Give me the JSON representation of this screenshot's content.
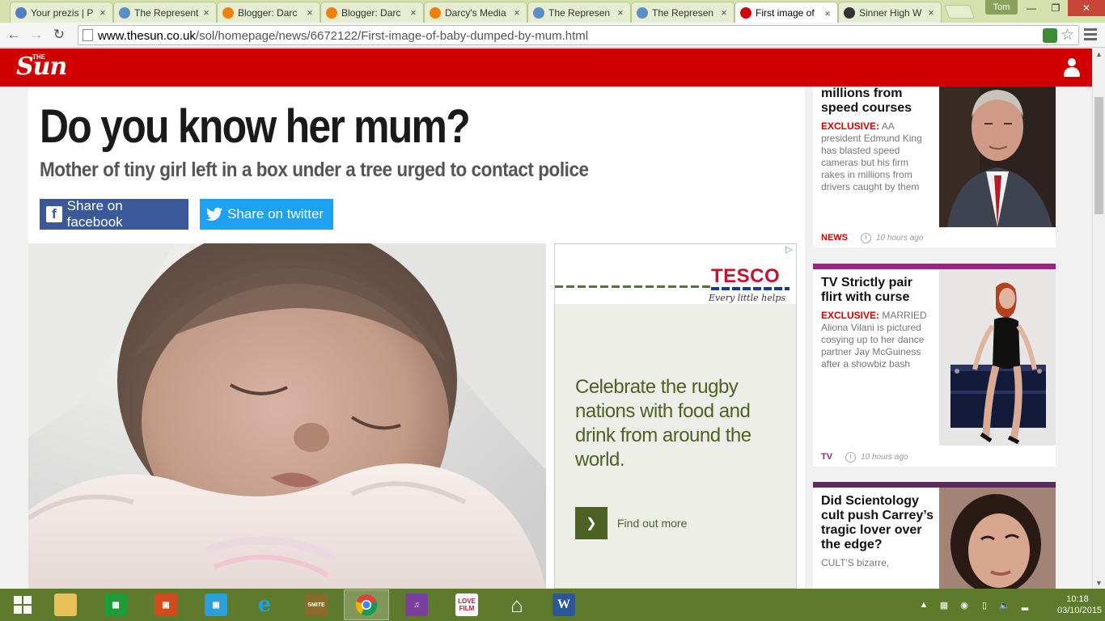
{
  "browser": {
    "tabs": [
      {
        "title": "Your prezis | P",
        "favicon": "prezi-icon",
        "color": "#4f7fbf"
      },
      {
        "title": "The Represent",
        "favicon": "globe-icon",
        "color": "#5a8fc6"
      },
      {
        "title": "Blogger: Darc",
        "favicon": "blogger-icon",
        "color": "#f57d00"
      },
      {
        "title": "Blogger: Darc",
        "favicon": "blogger-icon",
        "color": "#f57d00"
      },
      {
        "title": "Darcy's Media",
        "favicon": "blogger-icon",
        "color": "#f57d00"
      },
      {
        "title": "The Represen",
        "favicon": "globe-icon",
        "color": "#5a8fc6"
      },
      {
        "title": "The Represen",
        "favicon": "globe-icon",
        "color": "#5a8fc6"
      },
      {
        "title": "First image of",
        "favicon": "sun-icon",
        "color": "#d00000",
        "active": true
      },
      {
        "title": "Sinner High W",
        "favicon": "m-icon",
        "color": "#333333"
      }
    ],
    "profile_name": "Tom",
    "url_prefix": "www.thesun.co.uk",
    "url_path": "/sol/homepage/news/6672122/First-image-of-baby-dumped-by-mum.html"
  },
  "site": {
    "logo_small": "THE",
    "logo": "Sun"
  },
  "article": {
    "headline": "Do you know her mum?",
    "subheadline": "Mother of tiny girl left in a box under a tree urged to contact police",
    "share_facebook": "Share on facebook",
    "share_twitter": "Share on twitter"
  },
  "ad": {
    "brand": "TESCO",
    "tagline": "Every little helps",
    "copy": "Celebrate the rugby nations with food and drink from around the world.",
    "cta": "Find out more"
  },
  "sidebar": {
    "cards": [
      {
        "title": "millions from speed courses",
        "exclusive": "EXCLUSIVE:",
        "summary": "AA president Edmund King has blasted speed cameras but his firm rakes in millions from drivers caught by them",
        "section": "NEWS",
        "section_color": "#d00000",
        "time": "10 hours ago"
      },
      {
        "title": "TV Strictly pair flirt with curse",
        "exclusive": "EXCLUSIVE:",
        "summary": "MARRIED Aliona Vilani is pictured cosying up to her dance partner Jay McGuiness after a showbiz bash",
        "section": "TV",
        "section_color": "#8e2b82",
        "time": "10 hours ago"
      },
      {
        "title": "Did Scientology cult push Carrey’s tragic lover over the edge?",
        "summary": "CULT'S bizarre,"
      }
    ]
  },
  "taskbar": {
    "clock_time": "10:18",
    "clock_date": "03/10/2015"
  }
}
